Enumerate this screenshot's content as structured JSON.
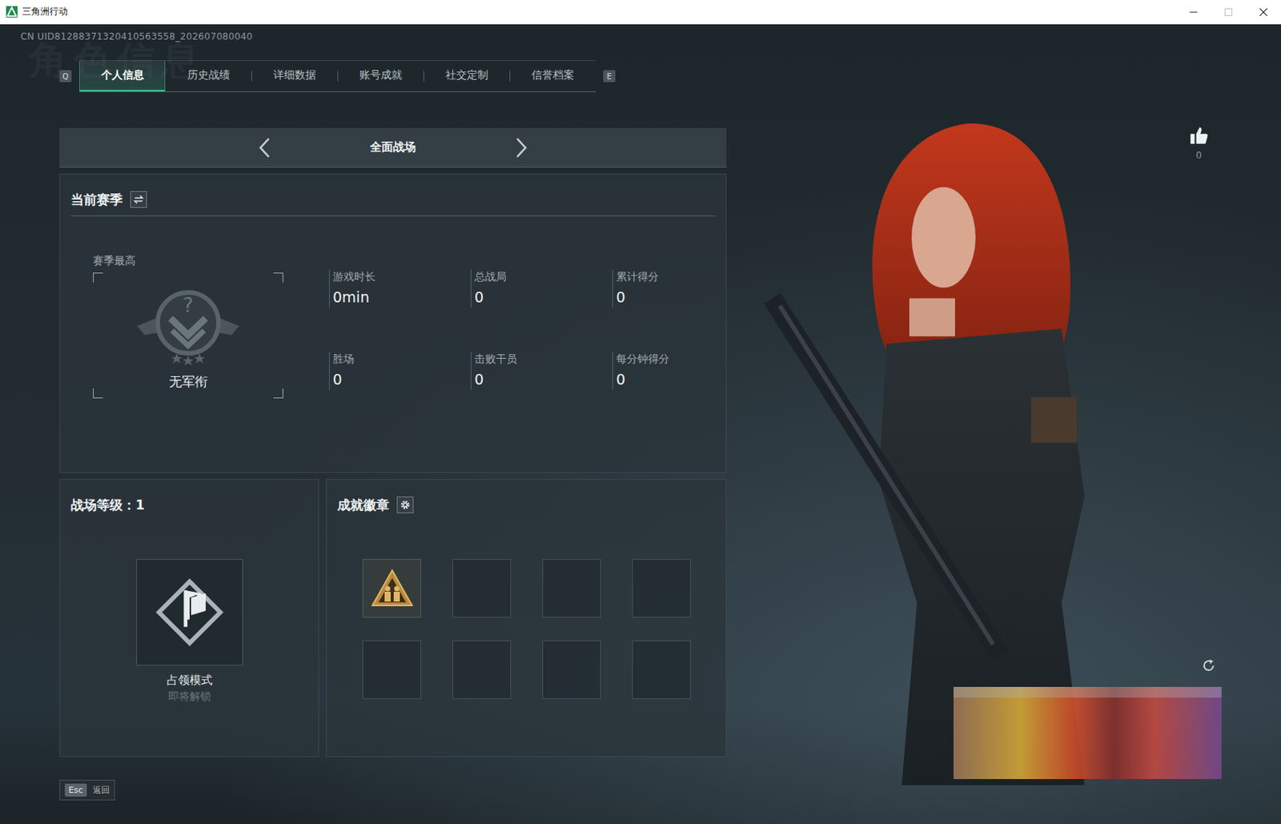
{
  "window": {
    "title": "三角洲行动",
    "controls": [
      {
        "kind": "minimize",
        "disabled": false
      },
      {
        "kind": "maximize",
        "disabled": true
      },
      {
        "kind": "close",
        "disabled": false
      }
    ]
  },
  "uid": "CN UID81288371320410563558_202607080040",
  "watermark": "角色信息",
  "tabbar": {
    "prev_key": "Q",
    "next_key": "E",
    "tabs": [
      {
        "label": "个人信息",
        "selected": true
      },
      {
        "label": "历史战绩",
        "selected": false
      },
      {
        "label": "详细数据",
        "selected": false
      },
      {
        "label": "账号成就",
        "selected": false
      },
      {
        "label": "社交定制",
        "selected": false
      },
      {
        "label": "信誉档案",
        "selected": false
      }
    ]
  },
  "mode_selector": {
    "label": "全面战场"
  },
  "season": {
    "title": "当前赛季",
    "rank_label": "赛季最高",
    "rank_icon": "?",
    "rank": "无军衔",
    "stats": [
      {
        "label": "游戏时长",
        "value": "0min"
      },
      {
        "label": "总战局",
        "value": "0"
      },
      {
        "label": "累计得分",
        "value": "0"
      },
      {
        "label": "胜场",
        "value": "0"
      },
      {
        "label": "击败干员",
        "value": "0"
      },
      {
        "label": "每分钟得分",
        "value": "0"
      }
    ]
  },
  "level": {
    "title": "战场等级：1",
    "mode": "占领模式",
    "status": "即将解锁",
    "locked": true
  },
  "badges": {
    "title": "成就徽章",
    "slots": [
      {
        "filled": true
      },
      {
        "filled": false
      },
      {
        "filled": false
      },
      {
        "filled": false
      },
      {
        "filled": false
      },
      {
        "filled": false
      },
      {
        "filled": false
      },
      {
        "filled": false
      }
    ]
  },
  "likes": {
    "count": "0"
  },
  "footer": {
    "key": "Esc",
    "label": "返回"
  }
}
